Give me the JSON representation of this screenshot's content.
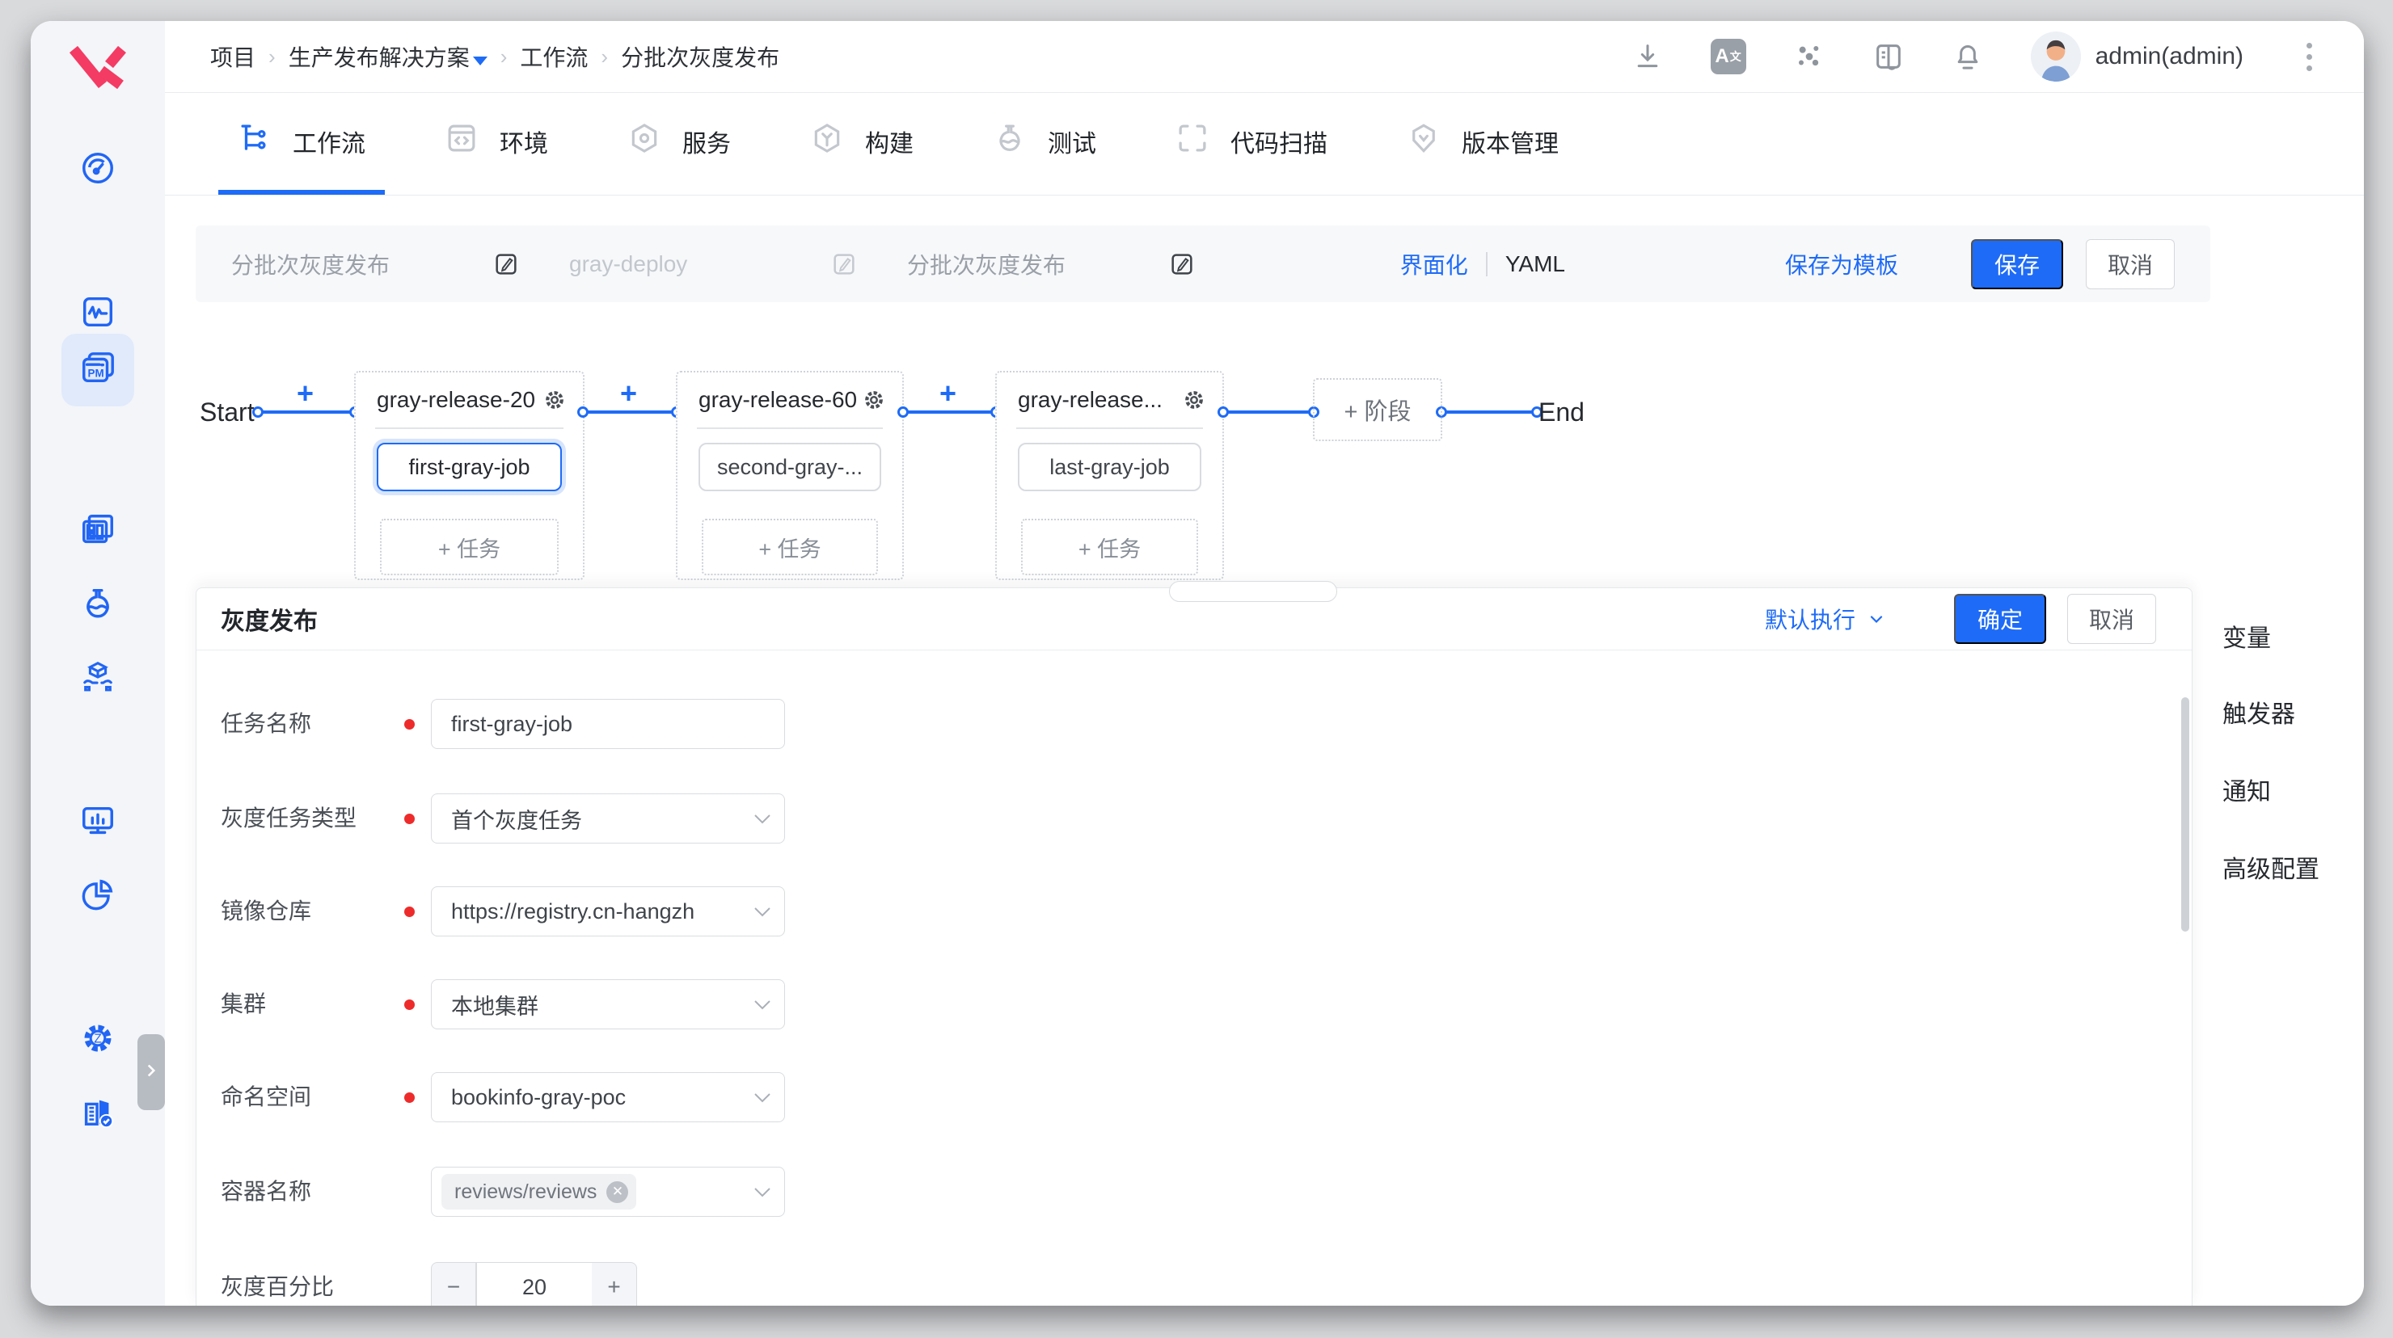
{
  "colors": {
    "accent": "#1e6bf7",
    "required_red": "#ee2b2b",
    "sidebar_icon_blue": "#2165f4",
    "logo_pink": "#f43b63"
  },
  "topbar": {
    "breadcrumb": [
      {
        "label": "项目"
      },
      {
        "label": "生产发布解决方案",
        "has_dropdown": true
      },
      {
        "label": "工作流"
      },
      {
        "label": "分批次灰度发布"
      }
    ],
    "icons": [
      "download-icon",
      "translate-icon",
      "cluster-icon",
      "docs-icon",
      "bell-icon"
    ],
    "translate_main": "A",
    "translate_sub": "文",
    "user_name": "admin(admin)"
  },
  "tabs": {
    "items": [
      {
        "label": "工作流",
        "active": true
      },
      {
        "label": "环境"
      },
      {
        "label": "服务"
      },
      {
        "label": "构建"
      },
      {
        "label": "测试"
      },
      {
        "label": "代码扫描"
      },
      {
        "label": "版本管理"
      }
    ]
  },
  "namesbar": {
    "fields": [
      {
        "value": "分批次灰度发布"
      },
      {
        "value": "gray-deploy",
        "disabled": true
      },
      {
        "value": "分批次灰度发布"
      }
    ],
    "view_toggle": {
      "ui": "界面化",
      "yaml": "YAML"
    },
    "save_template": "保存为模板",
    "save": "保存",
    "cancel": "取消"
  },
  "workflow": {
    "start_label": "Start",
    "end_label": "End",
    "add_stage_label": "+ 阶段",
    "add_task_label": "+ 任务",
    "connector_plus": "+",
    "stages": [
      {
        "name": "gray-release-20",
        "job": "first-gray-job",
        "selected": true
      },
      {
        "name": "gray-release-60",
        "job": "second-gray-..."
      },
      {
        "name": "gray-release...",
        "job": "last-gray-job"
      }
    ]
  },
  "panel": {
    "title": "灰度发布",
    "mode_label": "默认执行",
    "ok": "确定",
    "cancel": "取消",
    "fields": [
      {
        "label": "任务名称",
        "type": "input",
        "value": "first-gray-job",
        "required": true
      },
      {
        "label": "灰度任务类型",
        "type": "select",
        "value": "首个灰度任务",
        "required": true
      },
      {
        "label": "镜像仓库",
        "type": "select",
        "value": "https://registry.cn-hangzh",
        "required": true
      },
      {
        "label": "集群",
        "type": "select",
        "value": "本地集群",
        "required": true
      },
      {
        "label": "命名空间",
        "type": "select",
        "value": "bookinfo-gray-poc",
        "required": true
      },
      {
        "label": "容器名称",
        "type": "multiselect",
        "chip": "reviews/reviews",
        "required": false
      },
      {
        "label": "灰度百分比",
        "type": "stepper",
        "value": "20",
        "minus": "−",
        "plus": "+",
        "required": false
      }
    ]
  },
  "right_rail": {
    "items": [
      {
        "label": "变量"
      },
      {
        "label": "触发器"
      },
      {
        "label": "通知"
      },
      {
        "label": "高级配置"
      }
    ]
  },
  "sidebar": {
    "icons": [
      "dashboard-gauge-icon",
      "monitor-wave-icon",
      "project-pm-icon",
      "cards-icon",
      "flask-icon",
      "delivery-package-icon",
      "monitor-chart-icon",
      "pie-chart-icon",
      "settings-gear-icon",
      "org-building-icon"
    ]
  }
}
